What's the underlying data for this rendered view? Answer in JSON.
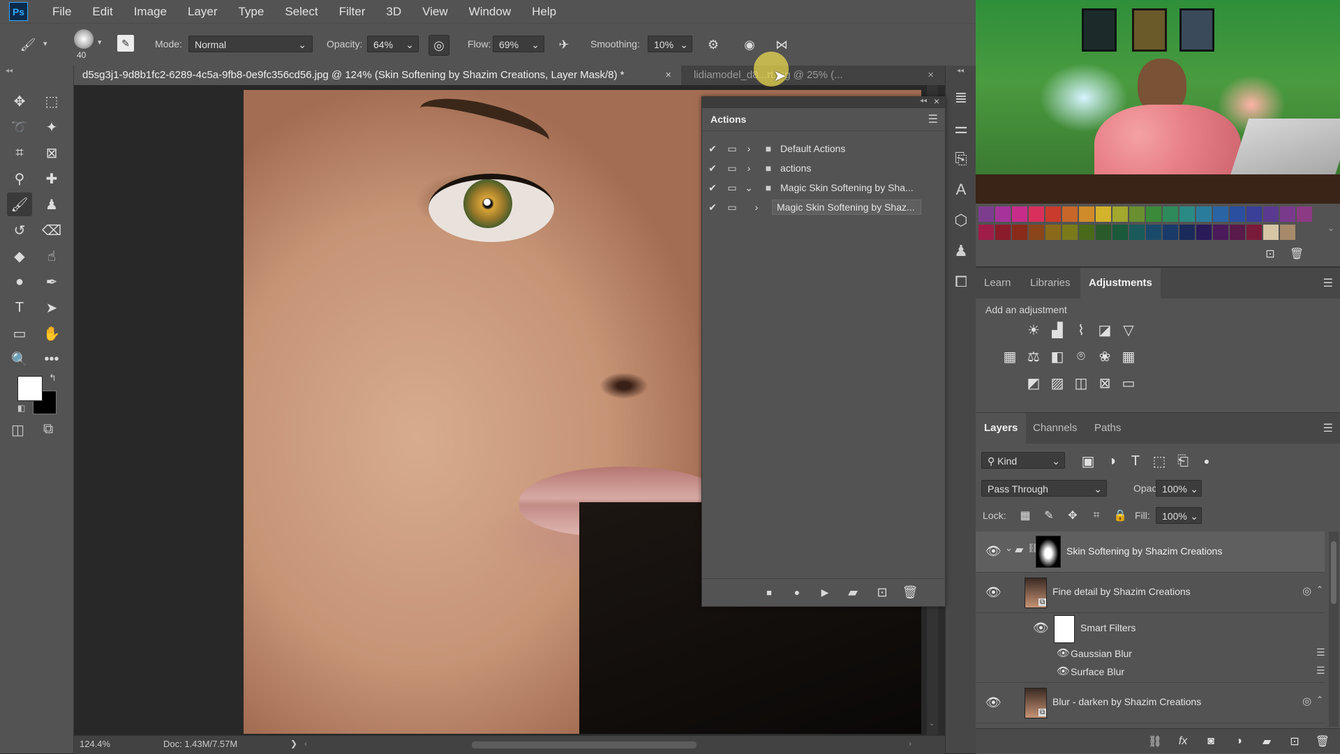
{
  "app": {
    "logo": "Ps"
  },
  "menu": [
    "File",
    "Edit",
    "Image",
    "Layer",
    "Type",
    "Select",
    "Filter",
    "3D",
    "View",
    "Window",
    "Help"
  ],
  "options": {
    "brush_size": "40",
    "mode_label": "Mode:",
    "mode_value": "Normal",
    "opacity_label": "Opacity:",
    "opacity_value": "64%",
    "flow_label": "Flow:",
    "flow_value": "69%",
    "smoothing_label": "Smoothing:",
    "smoothing_value": "10%"
  },
  "tabs": [
    {
      "label": "d5sg3j1-9d8b1fc2-6289-4c5a-9fb8-0e9fc356cd56.jpg @ 124% (Skin Softening by Shazim Creations, Layer Mask/8) *",
      "close": "×"
    },
    {
      "label": "lidiamodel_d8...rt.jpg @ 25% (...",
      "close": "×"
    }
  ],
  "status": {
    "zoom": "124.4%",
    "doc": "Doc: 1.43M/7.57M",
    "arrow": "❯"
  },
  "actions_panel": {
    "title": "Actions",
    "rows": [
      {
        "label": "Default Actions"
      },
      {
        "label": "actions"
      },
      {
        "label": "Magic Skin Softening by Sha..."
      },
      {
        "label": "Magic Skin Softening by Shaz..."
      }
    ]
  },
  "adjustments_panel": {
    "tabs": [
      "Learn",
      "Libraries",
      "Adjustments"
    ],
    "active_tab": "Adjustments",
    "subtitle": "Add an adjustment"
  },
  "layers_panel": {
    "tabs": [
      "Layers",
      "Channels",
      "Paths"
    ],
    "filter_kind": "Kind",
    "blend_mode": "Pass Through",
    "opacity_label": "Opacity:",
    "opacity_value": "100%",
    "lock_label": "Lock:",
    "fill_label": "Fill:",
    "fill_value": "100%",
    "layers": [
      {
        "name": "Skin Softening by Shazim Creations"
      },
      {
        "name": "Fine detail by Shazim Creations"
      },
      {
        "name": "Smart Filters"
      },
      {
        "name": "Gaussian Blur"
      },
      {
        "name": "Surface Blur"
      },
      {
        "name": "Blur - darken by Shazim Creations"
      }
    ]
  },
  "swatch_colors": {
    "row1": [
      "#7d3d8f",
      "#a6339b",
      "#c72c8a",
      "#d92f5d",
      "#c93b2c",
      "#c8662a",
      "#cf8b2a",
      "#d3b32b",
      "#a2a72d",
      "#6a8f31",
      "#3a8a3a",
      "#2e8a5a",
      "#2a8a84",
      "#2a7c9c",
      "#2a64a4",
      "#2a4ea0",
      "#3a3f98",
      "#5a3a90",
      "#7a3a8c",
      "#8c3a84"
    ],
    "row2": [
      "#a01d4a",
      "#8a1b2a",
      "#8a2a1a",
      "#8a461a",
      "#8a6a1a",
      "#7a7a1a",
      "#4a6a1a",
      "#2a5a2a",
      "#1a5a3a",
      "#1a5a5a",
      "#1a4a6a",
      "#1a3a6a",
      "#1a2a5a",
      "#2a1a5a",
      "#4a1a5a",
      "#5a1a4a",
      "#7a1a3a",
      "#d6c6a6",
      "#a68a6a"
    ]
  },
  "colors": {
    "panel": "#535353",
    "dark": "#3c3c3c",
    "accent": "#31a8ff",
    "highlight": "#5f5f5f"
  }
}
